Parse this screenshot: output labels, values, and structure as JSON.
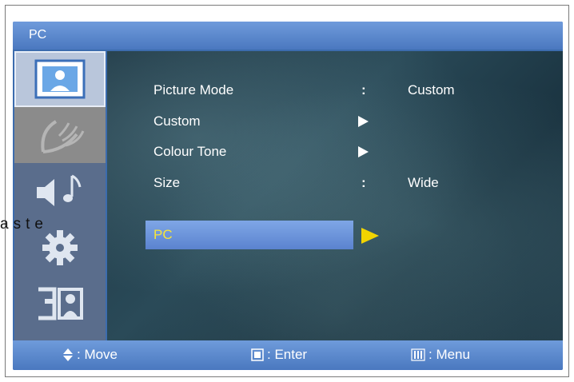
{
  "osd": {
    "title": "PC",
    "sidebar": [
      {
        "name": "picture",
        "icon": "picture-icon",
        "active": true
      },
      {
        "name": "channel",
        "icon": "antenna-icon",
        "active": false
      },
      {
        "name": "sound",
        "icon": "speaker-note-icon",
        "active": false
      },
      {
        "name": "setup",
        "icon": "gear-icon",
        "active": false
      },
      {
        "name": "input",
        "icon": "input-person-icon",
        "active": false
      }
    ],
    "menu": [
      {
        "label": "Picture Mode",
        "sep": ":",
        "value": "Custom",
        "arrow": false
      },
      {
        "label": "Custom",
        "sep": "",
        "value": "",
        "arrow": true
      },
      {
        "label": "Colour Tone",
        "sep": "",
        "value": "",
        "arrow": true
      },
      {
        "label": "Size",
        "sep": ":",
        "value": "Wide",
        "arrow": false
      },
      {
        "label": "PC",
        "sep": "",
        "value": "",
        "arrow": true,
        "selected": true
      }
    ],
    "footer": {
      "move": ": Move",
      "enter": ": Enter",
      "menu": ": Menu"
    }
  },
  "stray_text": "aste",
  "colors": {
    "accent": "#5b83cf",
    "selected_text": "#f6e53a",
    "arrow_selected": "#f2d400"
  }
}
